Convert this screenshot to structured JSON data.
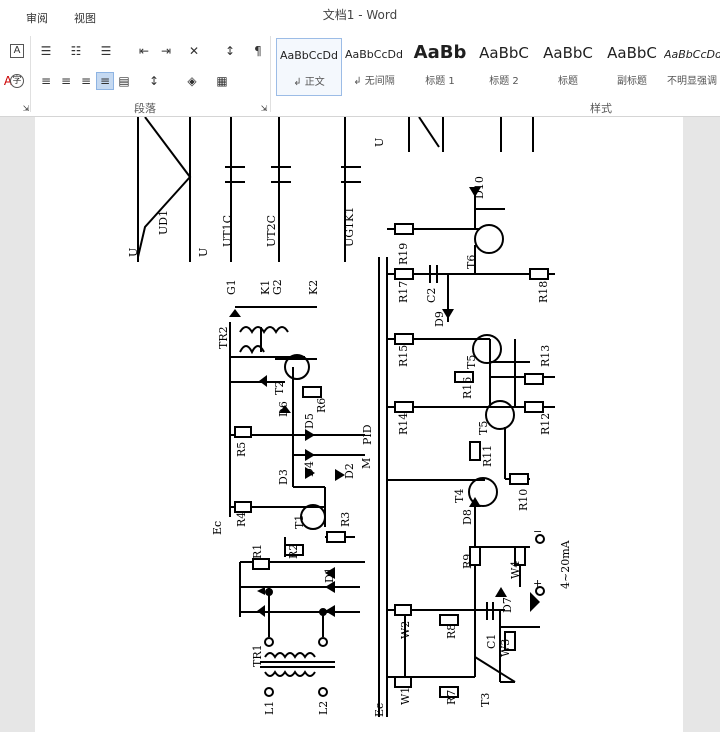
{
  "window": {
    "title": "文档1 - Word"
  },
  "tabs": {
    "review": "审阅",
    "view": "视图"
  },
  "ribbon": {
    "paragraph_group": "段落",
    "styles_group": "样式",
    "styles": [
      {
        "sample": "AaBbCcDd",
        "name": "↲ 正文"
      },
      {
        "sample": "AaBbCcDd",
        "name": "↲ 无间隔"
      },
      {
        "sample": "AaBb",
        "name": "标题 1"
      },
      {
        "sample": "AaBbC",
        "name": "标题 2"
      },
      {
        "sample": "AaBbC",
        "name": "标题"
      },
      {
        "sample": "AaBbC",
        "name": "副标题"
      },
      {
        "sample": "AaBbCcDd",
        "name": "不明显强调"
      }
    ]
  },
  "diagram": {
    "waveform_labels": [
      "UD1",
      "UT1C",
      "UT2C",
      "UG1K1",
      "U",
      "U",
      "U"
    ],
    "components": [
      "G1",
      "K1",
      "G2",
      "K2",
      "TR2",
      "T2",
      "D6",
      "D5",
      "R6",
      "R5",
      "PID",
      "D4",
      "D3",
      "D2",
      "M",
      "R4",
      "Ec",
      "T1",
      "R3",
      "R1",
      "R2",
      "D1",
      "TR1",
      "L1",
      "L2",
      "D10",
      "R19",
      "T6",
      "R17",
      "C2",
      "R18",
      "D9",
      "R15",
      "T5",
      "R13",
      "R16",
      "R14",
      "R12",
      "R11",
      "R10",
      "T4",
      "D8",
      "R9",
      "W4",
      "4~20mA",
      "D7",
      "W2",
      "R8",
      "C1",
      "W3",
      "W1",
      "R7",
      "T3",
      "Ec"
    ],
    "polarity_minus": "−",
    "polarity_plus": "+"
  }
}
